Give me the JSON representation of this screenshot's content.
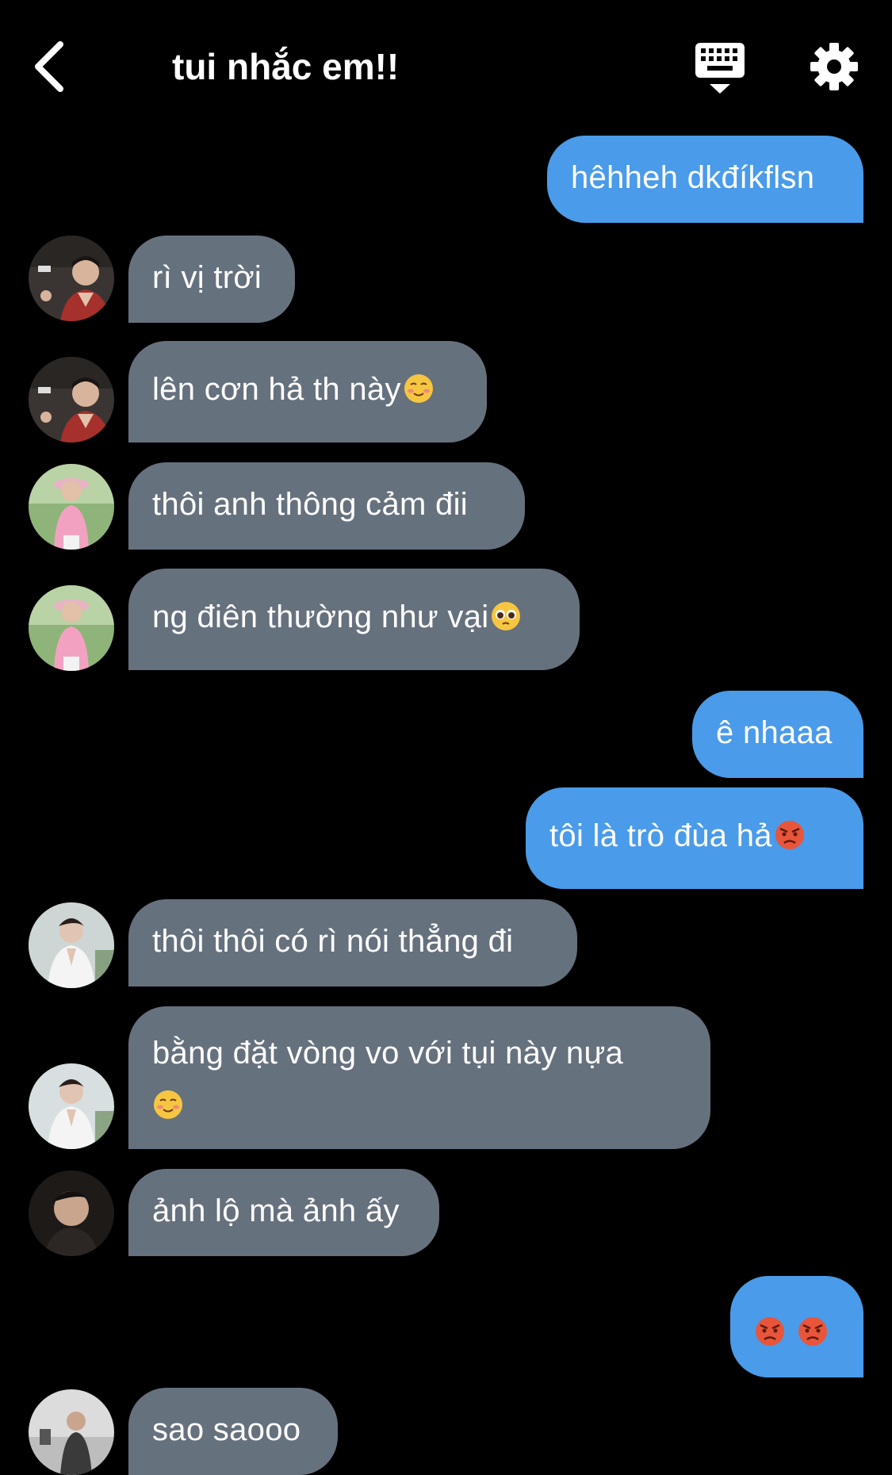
{
  "header": {
    "title": "tui nhắc em!!"
  },
  "messages": [
    {
      "side": "out",
      "text": "hêhheh dkđíkflsn"
    },
    {
      "side": "in",
      "text": "rì vị trời"
    },
    {
      "side": "in",
      "text": "lên cơn hả th này",
      "emoji": "smiling-blush-emoji"
    },
    {
      "side": "in",
      "text": "thôi anh thông cảm đii"
    },
    {
      "side": "in",
      "text": "ng điên thường như vại",
      "emoji": "pleading-face-emoji"
    },
    {
      "side": "out",
      "text": "ê nhaaa"
    },
    {
      "side": "out",
      "text": "tôi là trò đùa hả",
      "emoji": "angry-face-emoji"
    },
    {
      "side": "in",
      "text": "thôi thôi có rì nói thẳng đi"
    },
    {
      "side": "in",
      "text": "bằng đặt vòng vo với tụi này nựa",
      "emoji": "smiling-blush-emoji"
    },
    {
      "side": "in",
      "text": "ảnh lộ mà ảnh ấy"
    },
    {
      "side": "out",
      "text": "",
      "emoji": "angry-face-emoji x2"
    },
    {
      "side": "in",
      "text": "sao saooo"
    }
  ],
  "colors": {
    "background": "#000000",
    "incoming_bubble": "#66717e",
    "outgoing_bubble": "#4a9be9",
    "text": "#ffffff"
  }
}
